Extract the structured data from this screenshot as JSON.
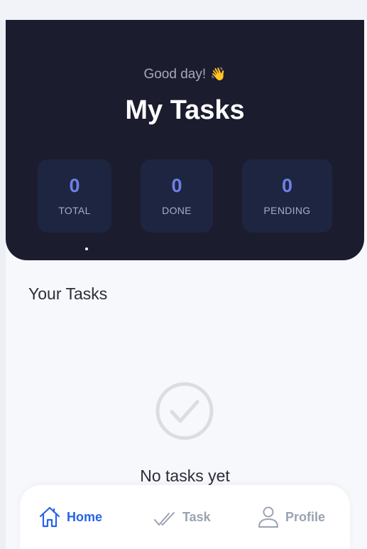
{
  "hero": {
    "greeting": "Good day!",
    "greeting_emoji": "👋",
    "title": "My Tasks"
  },
  "stats": [
    {
      "value": "0",
      "label": "TOTAL"
    },
    {
      "value": "0",
      "label": "DONE"
    },
    {
      "value": "0",
      "label": "PENDING"
    }
  ],
  "tasks": {
    "section_title": "Your Tasks",
    "empty_text": "No tasks yet"
  },
  "nav": {
    "items": [
      {
        "label": "Home",
        "icon": "home-icon",
        "active": true
      },
      {
        "label": "Task",
        "icon": "double-check-icon",
        "active": false
      },
      {
        "label": "Profile",
        "icon": "user-icon",
        "active": false
      }
    ]
  },
  "colors": {
    "hero_bg": "#1b1c2e",
    "stat_card_bg": "#1e2540",
    "stat_value": "#6f7fe6",
    "accent": "#2563eb",
    "inactive_nav": "#9aa3b2"
  }
}
